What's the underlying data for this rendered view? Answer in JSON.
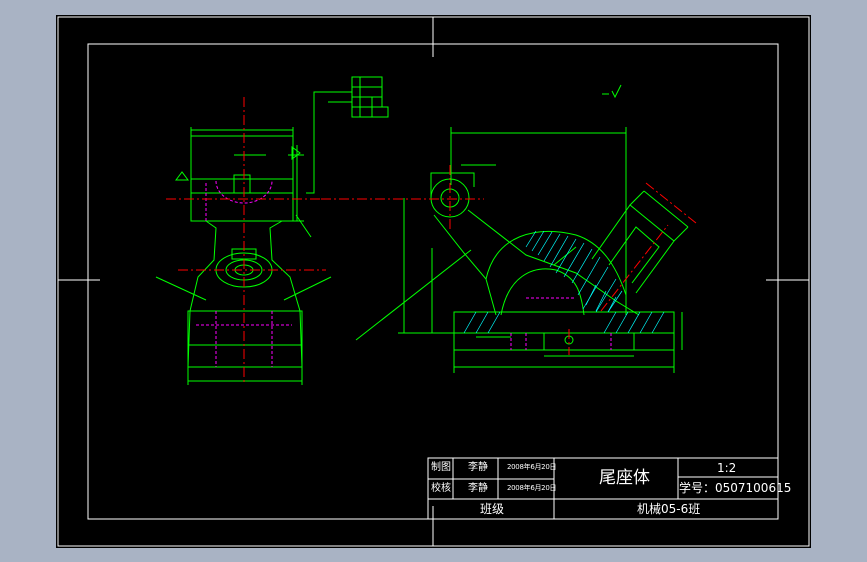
{
  "app": {
    "background_color": "#a9b3c4",
    "canvas_color": "#000000"
  },
  "colors": {
    "outline": "#ffffff",
    "geometry": "#00ff00",
    "centerline": "#ff0000",
    "hidden": "#ff00ff",
    "hatch": "#00ffff",
    "dimension": "#00ff00"
  },
  "title_block": {
    "row1": {
      "role": "制图",
      "name": "李静",
      "date": "2008年6月20日"
    },
    "row2": {
      "role": "校核",
      "name": "李静",
      "date": "2008年6月20日"
    },
    "class_label": "班级",
    "part_name": "尾座体",
    "scale": "1:2",
    "student_id": "学号：0507100615",
    "class_name": "机械05-6班"
  }
}
